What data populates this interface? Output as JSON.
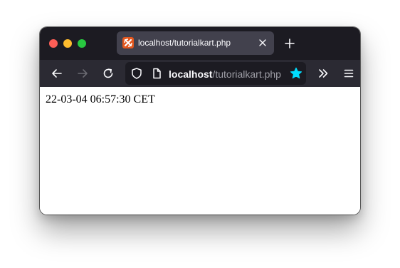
{
  "browser": {
    "tab": {
      "title": "localhost/tutorialkart.php",
      "favicon": "xampp-icon",
      "favicon_color": "#e2571e"
    },
    "url": {
      "host": "localhost",
      "path": "/tutorialkart.php"
    },
    "colors": {
      "titlebar": "#1c1b22",
      "toolbar": "#2b2a33",
      "bookmark_star": "#00ddff"
    }
  },
  "page": {
    "output_text": "22-03-04 06:57:30 CET"
  }
}
